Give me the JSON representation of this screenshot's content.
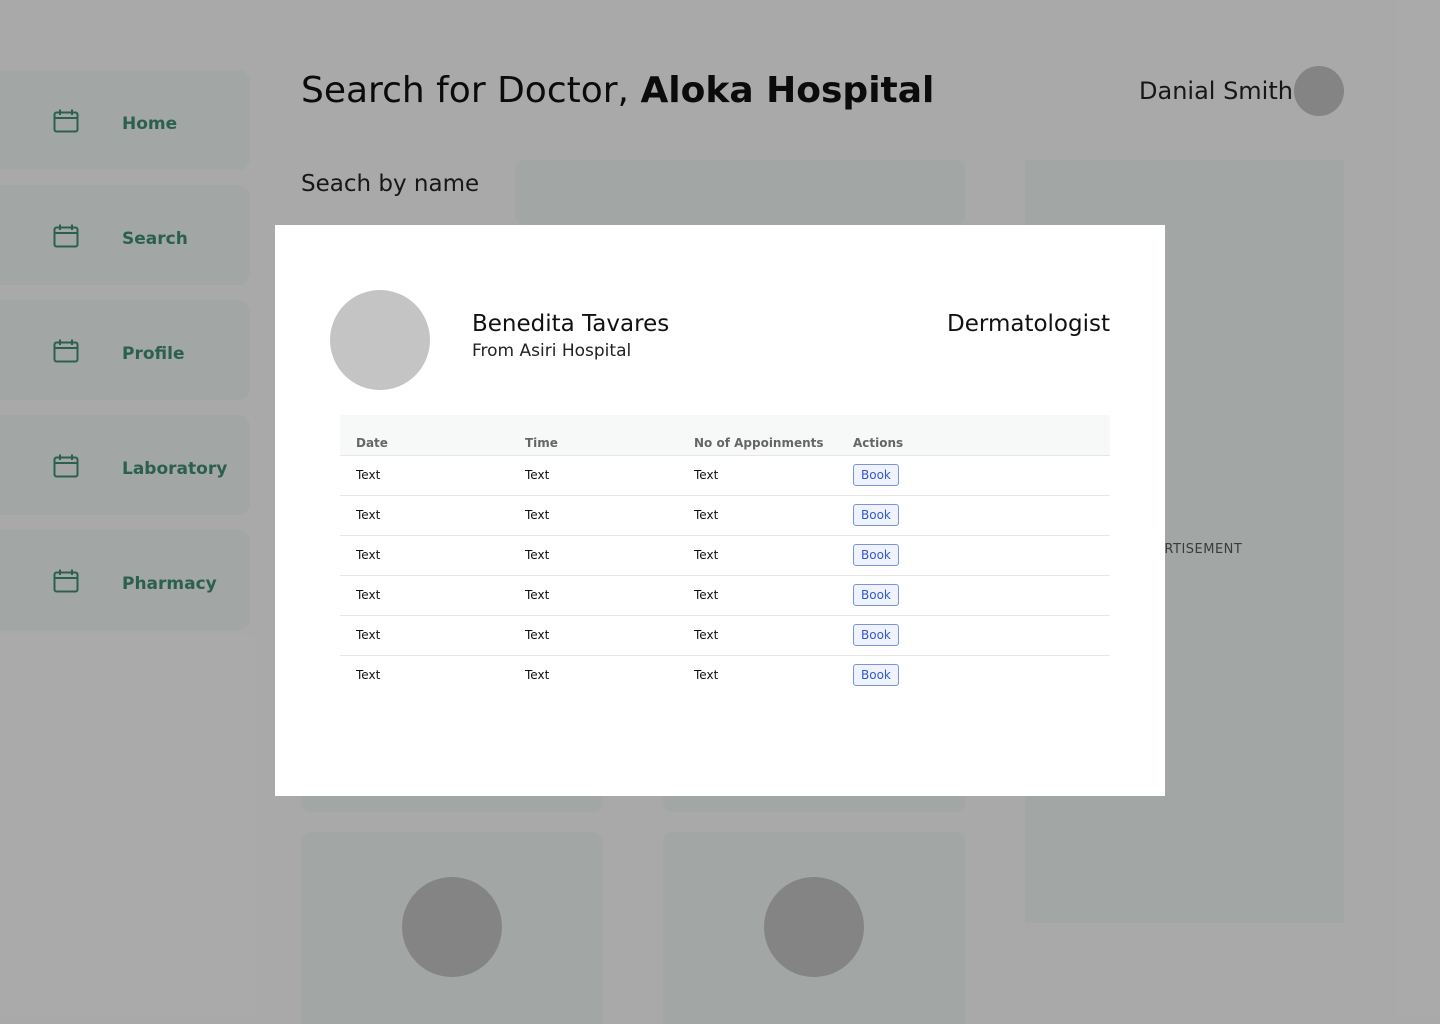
{
  "sidebar": {
    "items": [
      {
        "label": "Home",
        "icon": "calendar-icon"
      },
      {
        "label": "Search",
        "icon": "calendar-icon"
      },
      {
        "label": "Profile",
        "icon": "calendar-icon"
      },
      {
        "label": "Laboratory",
        "icon": "calendar-icon"
      },
      {
        "label": "Pharmacy",
        "icon": "calendar-icon"
      }
    ]
  },
  "header": {
    "title_prefix": "Search for Doctor, ",
    "title_hospital": "Aloka Hospital",
    "user_name": "Danial Smith"
  },
  "search": {
    "label": "Seach by name",
    "value": ""
  },
  "ad": {
    "label": "ADVERTISEMENT"
  },
  "modal": {
    "doctor_name": "Benedita Tavares",
    "doctor_hospital": "From Asiri Hospital",
    "specialty": "Dermatologist",
    "table": {
      "headers": [
        "Date",
        "Time",
        "No of Appoinments",
        "Actions"
      ],
      "rows": [
        {
          "date": "Text",
          "time": "Text",
          "appointments": "Text",
          "action": "Book"
        },
        {
          "date": "Text",
          "time": "Text",
          "appointments": "Text",
          "action": "Book"
        },
        {
          "date": "Text",
          "time": "Text",
          "appointments": "Text",
          "action": "Book"
        },
        {
          "date": "Text",
          "time": "Text",
          "appointments": "Text",
          "action": "Book"
        },
        {
          "date": "Text",
          "time": "Text",
          "appointments": "Text",
          "action": "Book"
        },
        {
          "date": "Text",
          "time": "Text",
          "appointments": "Text",
          "action": "Book"
        }
      ]
    }
  },
  "colors": {
    "accent_green": "#3f8a70",
    "panel_bg": "#e8eeec",
    "book_button": "#3558c9"
  }
}
